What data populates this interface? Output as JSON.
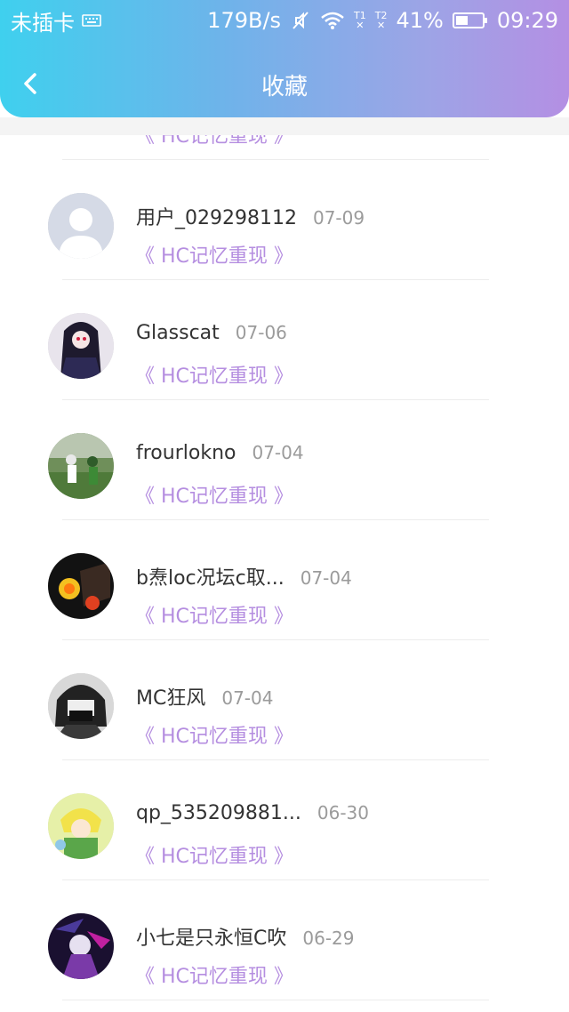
{
  "status_bar": {
    "carrier": "未插卡",
    "speed": "179B/s",
    "sim1": "T1",
    "sim2": "T2",
    "battery": "41%",
    "time": "09:29"
  },
  "nav": {
    "title": "收藏"
  },
  "items": [
    {
      "name": "",
      "date": "",
      "tag": "《 HC记忆重现 》"
    },
    {
      "name": "用户_029298112",
      "date": "07-09",
      "tag": "《 HC记忆重现 》"
    },
    {
      "name": "Glasscat",
      "date": "07-06",
      "tag": "《 HC记忆重现 》"
    },
    {
      "name": "frourlokno",
      "date": "07-04",
      "tag": "《 HC记忆重现 》"
    },
    {
      "name": "b焘loc况坛c取...",
      "date": "07-04",
      "tag": "《 HC记忆重现 》"
    },
    {
      "name": "MC狂风",
      "date": "07-04",
      "tag": "《 HC记忆重现 》"
    },
    {
      "name": "qp_535209881...",
      "date": "06-30",
      "tag": "《 HC记忆重现 》"
    },
    {
      "name": "小七是只永恒C吹",
      "date": "06-29",
      "tag": "《 HC记忆重现 》"
    }
  ]
}
